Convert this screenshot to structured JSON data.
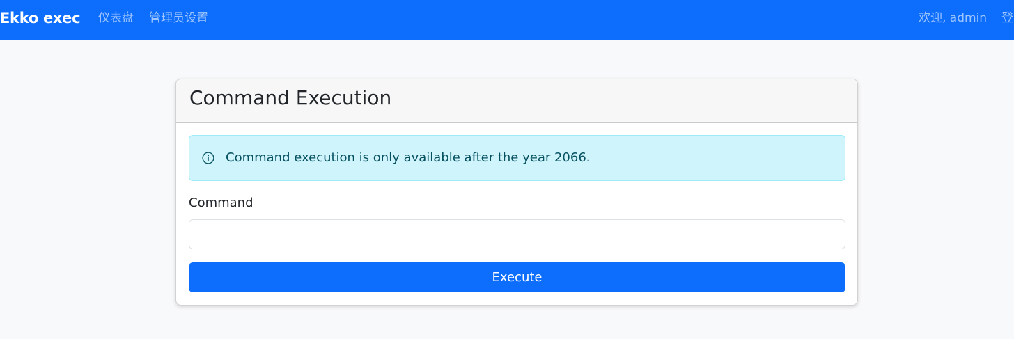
{
  "navbar": {
    "brand": "Ekko exec",
    "links": {
      "dashboard": "仪表盘",
      "admin_settings": "管理员设置"
    },
    "welcome": "欢迎, admin",
    "logout": "登"
  },
  "card": {
    "title": "Command Execution",
    "alert": {
      "icon": "info-circle-icon",
      "text": "Command execution is only available after the year 2066."
    },
    "form": {
      "command_label": "Command",
      "command_value": "",
      "command_placeholder": "",
      "execute_label": "Execute"
    }
  },
  "colors": {
    "primary": "#0d6efd",
    "alert_bg": "#cff4fc",
    "alert_text": "#055160",
    "page_bg": "#f8f9fa"
  }
}
